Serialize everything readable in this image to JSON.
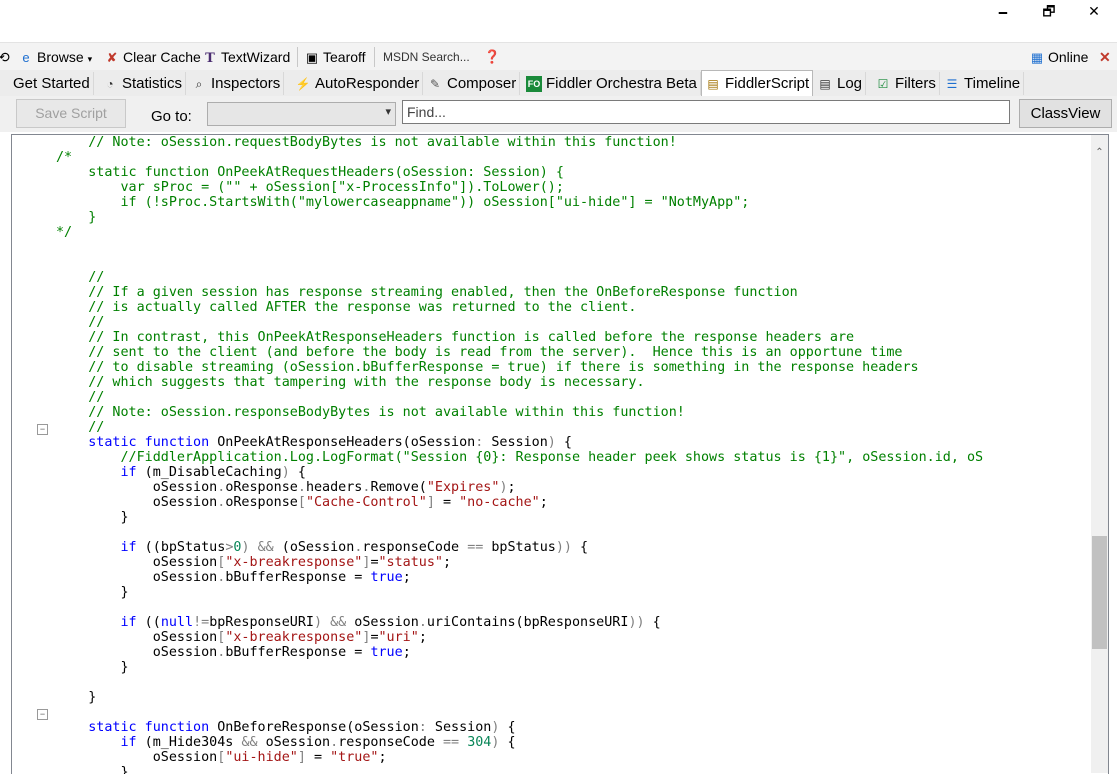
{
  "window": {
    "minimize": "🗕",
    "maximize": "🗗",
    "close": "✕"
  },
  "toolbar": {
    "items": [
      "Browse",
      "Clear Cache",
      "TextWizard",
      "Tearoff",
      "MSDN Search...",
      "Online"
    ],
    "icons": [
      "browser-icon",
      "clear-cache-icon",
      "textwizard-icon",
      "tearoff-icon",
      "help-icon",
      "online-icon",
      "close-icon"
    ]
  },
  "tabs": [
    {
      "label": "Get Started",
      "icon": ""
    },
    {
      "label": "Statistics",
      "icon": "statistics-icon"
    },
    {
      "label": "Inspectors",
      "icon": "inspectors-icon"
    },
    {
      "label": "AutoResponder",
      "icon": "autoresponder-icon"
    },
    {
      "label": "Composer",
      "icon": "composer-icon"
    },
    {
      "label": "Fiddler Orchestra Beta",
      "icon": "FO"
    },
    {
      "label": "FiddlerScript",
      "icon": "fiddlerscript-icon"
    },
    {
      "label": "Log",
      "icon": "log-icon"
    },
    {
      "label": "Filters",
      "icon": "filters-icon"
    },
    {
      "label": "Timeline",
      "icon": "timeline-icon"
    }
  ],
  "script_bar": {
    "save_label": "Save Script",
    "goto_label": "Go to:",
    "goto_value": "",
    "find_placeholder": "Find...",
    "classview_label": "ClassView"
  },
  "code_lines": [
    [
      [
        "cm",
        "    // Note: oSession.requestBodyBytes is not available within this function!"
      ]
    ],
    [
      [
        "cm",
        "/*"
      ]
    ],
    [
      [
        "cm",
        "    static function OnPeekAtRequestHeaders(oSession: Session) {"
      ]
    ],
    [
      [
        "cm",
        "        var sProc = (\"\" + oSession[\"x-ProcessInfo\"]).ToLower();"
      ]
    ],
    [
      [
        "cm",
        "        if (!sProc.StartsWith(\"mylowercaseappname\")) oSession[\"ui-hide\"] = \"NotMyApp\";"
      ]
    ],
    [
      [
        "cm",
        "    }"
      ]
    ],
    [
      [
        "cm",
        "*/"
      ]
    ],
    [
      [
        "",
        ""
      ]
    ],
    [
      [
        "",
        ""
      ]
    ],
    [
      [
        "cm",
        "    //"
      ]
    ],
    [
      [
        "cm",
        "    // If a given session has response streaming enabled, then the OnBeforeResponse function"
      ]
    ],
    [
      [
        "cm",
        "    // is actually called AFTER the response was returned to the client."
      ]
    ],
    [
      [
        "cm",
        "    //"
      ]
    ],
    [
      [
        "cm",
        "    // In contrast, this OnPeekAtResponseHeaders function is called before the response headers are"
      ]
    ],
    [
      [
        "cm",
        "    // sent to the client (and before the body is read from the server).  Hence this is an opportune time"
      ]
    ],
    [
      [
        "cm",
        "    // to disable streaming (oSession.bBufferResponse = true) if there is something in the response headers"
      ]
    ],
    [
      [
        "cm",
        "    // which suggests that tampering with the response body is necessary."
      ]
    ],
    [
      [
        "cm",
        "    //"
      ]
    ],
    [
      [
        "cm",
        "    // Note: oSession.responseBodyBytes is not available within this function!"
      ]
    ],
    [
      [
        "cm",
        "    //"
      ]
    ],
    [
      [
        "",
        "    "
      ],
      [
        "kw",
        "static function"
      ],
      [
        "",
        " OnPeekAtResponseHeaders(oSession"
      ],
      [
        "op",
        ":"
      ],
      [
        "",
        " Session"
      ],
      [
        "op",
        ")"
      ],
      [
        "",
        " {"
      ]
    ],
    [
      [
        "",
        "        "
      ],
      [
        "cm",
        "//FiddlerApplication.Log.LogFormat(\"Session {0}: Response header peek shows status is {1}\", oSession.id, oS"
      ]
    ],
    [
      [
        "",
        "        "
      ],
      [
        "kw",
        "if"
      ],
      [
        "",
        " ("
      ],
      [
        "",
        "m_DisableCaching"
      ],
      [
        "op",
        ")"
      ],
      [
        "",
        " {"
      ]
    ],
    [
      [
        "",
        "            oSession"
      ],
      [
        "op",
        "."
      ],
      [
        "",
        "oResponse"
      ],
      [
        "op",
        "."
      ],
      [
        "",
        "headers"
      ],
      [
        "op",
        "."
      ],
      [
        "",
        "Remove("
      ],
      [
        "st",
        "\"Expires\""
      ],
      [
        "op",
        ")"
      ],
      [
        "",
        ";"
      ]
    ],
    [
      [
        "",
        "            oSession"
      ],
      [
        "op",
        "."
      ],
      [
        "",
        "oResponse"
      ],
      [
        "op",
        "["
      ],
      [
        "st",
        "\"Cache-Control\""
      ],
      [
        "op",
        "]"
      ],
      [
        "",
        " = "
      ],
      [
        "st",
        "\"no-cache\""
      ],
      [
        "",
        ";"
      ]
    ],
    [
      [
        "",
        "        }"
      ]
    ],
    [
      [
        "",
        ""
      ]
    ],
    [
      [
        "",
        "        "
      ],
      [
        "kw",
        "if"
      ],
      [
        "",
        " (("
      ],
      [
        "",
        "bpStatus"
      ],
      [
        "op",
        ">"
      ],
      [
        "nm",
        "0"
      ],
      [
        "op",
        ")"
      ],
      [
        "",
        " "
      ],
      [
        "op",
        "&&"
      ],
      [
        "",
        " ("
      ],
      [
        "",
        "oSession"
      ],
      [
        "op",
        "."
      ],
      [
        "",
        "responseCode"
      ],
      [
        "",
        " "
      ],
      [
        "op",
        "=="
      ],
      [
        "",
        " bpStatus"
      ],
      [
        "op",
        "))"
      ],
      [
        "",
        " {"
      ]
    ],
    [
      [
        "",
        "            oSession"
      ],
      [
        "op",
        "["
      ],
      [
        "st",
        "\"x-breakresponse\""
      ],
      [
        "op",
        "]"
      ],
      [
        "",
        "="
      ],
      [
        "st",
        "\"status\""
      ],
      [
        "",
        ";"
      ]
    ],
    [
      [
        "",
        "            oSession"
      ],
      [
        "op",
        "."
      ],
      [
        "",
        "bBufferResponse = "
      ],
      [
        "kw",
        "true"
      ],
      [
        "",
        ";"
      ]
    ],
    [
      [
        "",
        "        }"
      ]
    ],
    [
      [
        "",
        ""
      ]
    ],
    [
      [
        "",
        "        "
      ],
      [
        "kw",
        "if"
      ],
      [
        "",
        " (("
      ],
      [
        "kw",
        "null"
      ],
      [
        "op",
        "!="
      ],
      [
        "",
        "bpResponseURI"
      ],
      [
        "op",
        ")"
      ],
      [
        "",
        " "
      ],
      [
        "op",
        "&&"
      ],
      [
        "",
        " oSession"
      ],
      [
        "op",
        "."
      ],
      [
        "",
        "uriContains("
      ],
      [
        "",
        "bpResponseURI"
      ],
      [
        "op",
        "))"
      ],
      [
        "",
        " {"
      ]
    ],
    [
      [
        "",
        "            oSession"
      ],
      [
        "op",
        "["
      ],
      [
        "st",
        "\"x-breakresponse\""
      ],
      [
        "op",
        "]"
      ],
      [
        "",
        "="
      ],
      [
        "st",
        "\"uri\""
      ],
      [
        "",
        ";"
      ]
    ],
    [
      [
        "",
        "            oSession"
      ],
      [
        "op",
        "."
      ],
      [
        "",
        "bBufferResponse = "
      ],
      [
        "kw",
        "true"
      ],
      [
        "",
        ";"
      ]
    ],
    [
      [
        "",
        "        }"
      ]
    ],
    [
      [
        "",
        ""
      ]
    ],
    [
      [
        "",
        "    }"
      ]
    ],
    [
      [
        "",
        ""
      ]
    ],
    [
      [
        "",
        "    "
      ],
      [
        "kw",
        "static function"
      ],
      [
        "",
        " OnBeforeResponse(oSession"
      ],
      [
        "op",
        ":"
      ],
      [
        "",
        " Session"
      ],
      [
        "op",
        ")"
      ],
      [
        "",
        " {"
      ]
    ],
    [
      [
        "",
        "        "
      ],
      [
        "kw",
        "if"
      ],
      [
        "",
        " (m_Hide304s "
      ],
      [
        "op",
        "&&"
      ],
      [
        "",
        " oSession"
      ],
      [
        "op",
        "."
      ],
      [
        "",
        "responseCode "
      ],
      [
        "op",
        "=="
      ],
      [
        "",
        " "
      ],
      [
        "nm",
        "304"
      ],
      [
        "op",
        ")"
      ],
      [
        "",
        " {"
      ]
    ],
    [
      [
        "",
        "            oSession"
      ],
      [
        "op",
        "["
      ],
      [
        "st",
        "\"ui-hide\""
      ],
      [
        "op",
        "]"
      ],
      [
        "",
        " = "
      ],
      [
        "st",
        "\"true\""
      ],
      [
        "",
        ";"
      ]
    ],
    [
      [
        "",
        "        }"
      ]
    ]
  ]
}
